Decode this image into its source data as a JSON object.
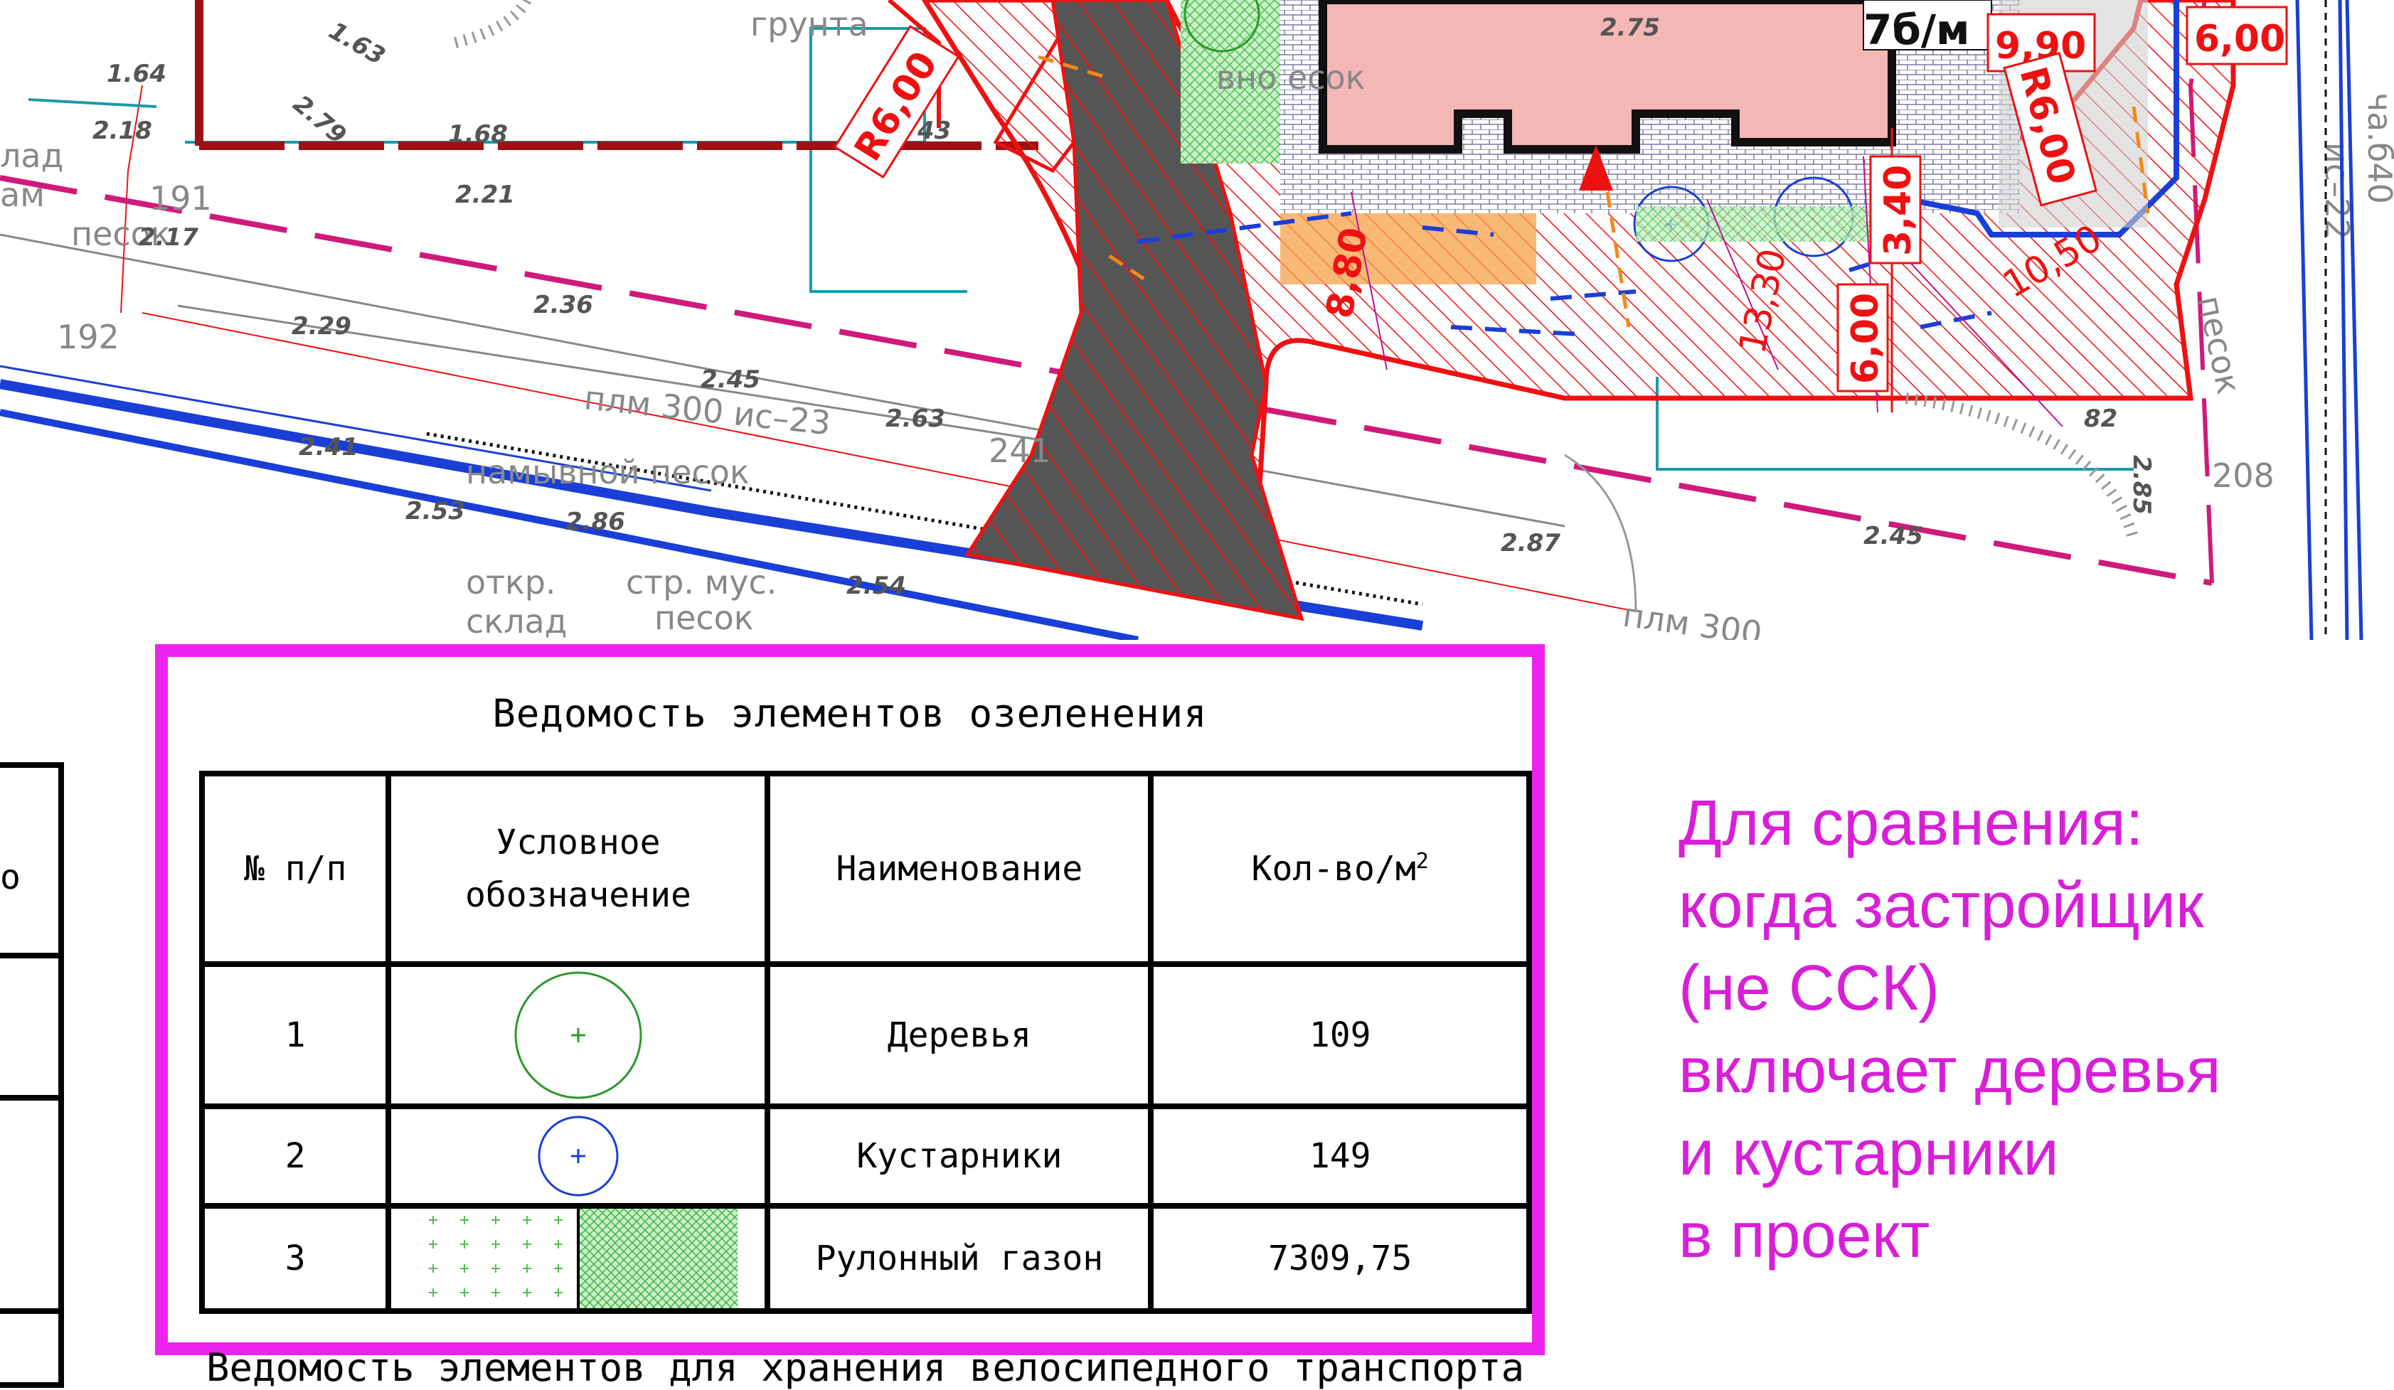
{
  "plan": {
    "labels": {
      "grunta": "грунта",
      "r600_left": "R6,00",
      "r600_right": "R6,00",
      "dim_990": "9,90",
      "dim_600_top": "6,00",
      "dim_600_mid": "6,00",
      "dim_340": "3,40",
      "dim_880": "8,80",
      "dim_1330": "13,30",
      "dim_1050": "10,50",
      "tbm": "7б/м",
      "sand_top": "вно   есок",
      "sand_small": "песок",
      "lad": "лад",
      "am": "ам",
      "n191": "191",
      "n192": "192",
      "plm300_mid": "плм 300  ис–23",
      "namyvnoi": "намывной  песок",
      "otkr": "откр.",
      "sklad": "склад",
      "strmus": "стр. мус.",
      "pesok2": "песок",
      "n241": "241",
      "n208": "208",
      "plm300_bot": "плм 300",
      "is22": "ис–22",
      "right_vert": "ча.б40",
      "pesok_vert": "песок",
      "mark_217": "2.17",
      "mark_229": "2.29",
      "mark_236": "2.36",
      "mark_245": "2.45",
      "mark_263": "2.63",
      "mark_241": "2.41",
      "mark_253": "2.53",
      "mark_286": "2.86",
      "mark_254": "2.54",
      "mark_287": "2.87",
      "mark_245b": "2.45",
      "mark_221": "2.21",
      "mark_168": "1.68",
      "mark_279": "2.79",
      "mark_163": "1.63",
      "mark_164": "1.64",
      "mark_218": "2.18",
      "mark_275": "2.75",
      "mark_285": "2.85",
      "mark_82": "82",
      "mark_43": "43"
    }
  },
  "schedule": {
    "title": "Ведомость элементов озеленения",
    "headers": [
      "№ п/п",
      "Условное обозначение",
      "Наименование",
      "Кол-во/м",
      "2"
    ],
    "rows": [
      {
        "num": "1",
        "symbol": "tree-circle-green",
        "name": "Деревья",
        "qty": "109"
      },
      {
        "num": "2",
        "symbol": "shrub-circle-blue",
        "name": "Кустарники",
        "qty": "149"
      },
      {
        "num": "3",
        "symbol": "lawn-hatch-green",
        "name": "Рулонный газон",
        "qty": "7309,75"
      }
    ]
  },
  "left_fragment": "о",
  "bottom_title": "Ведомость элементов для хранения велосипедного транспорта",
  "note": {
    "lines": [
      "Для сравнения:",
      "когда застройщик",
      "(не ССК)",
      "включает деревья",
      "и кустарники",
      "в проект"
    ]
  },
  "colors": {
    "frame": "#ee22ee",
    "note": "#d81fd8",
    "red": "#ee1111",
    "blue": "#1a3fd6",
    "tree": "#2a9a2a",
    "lawn": "#7fd27f",
    "building": "#f5b6b6"
  }
}
